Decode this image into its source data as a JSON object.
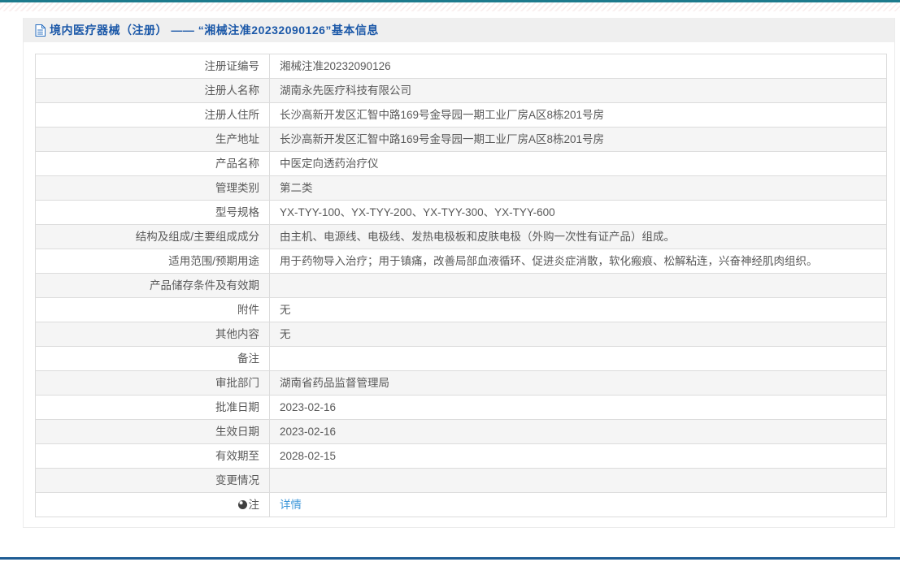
{
  "header": {
    "title": "境内医疗器械（注册） —— “湘械注准20232090126”基本信息"
  },
  "icons": {
    "document_icon": "document-outline-icon",
    "note_icon": "dark-circle-note-icon"
  },
  "colors": {
    "top_line_teal": "#1d7a8c",
    "bottom_line_blue": "#1e5c94",
    "title_blue": "#1b58a8",
    "link_blue": "#3e97d9",
    "header_bar_gray": "#efefef",
    "row_alt_gray": "#f5f5f5",
    "table_border": "#dcdcdc",
    "text_gray": "#595959"
  },
  "table": {
    "rows": [
      {
        "label": "注册证编号",
        "value": "湘械注准20232090126"
      },
      {
        "label": "注册人名称",
        "value": "湖南永先医疗科技有限公司"
      },
      {
        "label": "注册人住所",
        "value": "长沙高新开发区汇智中路169号金导园一期工业厂房A区8栋201号房"
      },
      {
        "label": "生产地址",
        "value": "长沙高新开发区汇智中路169号金导园一期工业厂房A区8栋201号房"
      },
      {
        "label": "产品名称",
        "value": "中医定向透药治疗仪"
      },
      {
        "label": "管理类别",
        "value": "第二类"
      },
      {
        "label": "型号规格",
        "value": "YX-TYY-100、YX-TYY-200、YX-TYY-300、YX-TYY-600"
      },
      {
        "label": "结构及组成/主要组成成分",
        "value": "由主机、电源线、电极线、发热电极板和皮肤电极（外购一次性有证产品）组成。"
      },
      {
        "label": "适用范围/预期用途",
        "value": "用于药物导入治疗；用于镇痛，改善局部血液循环、促进炎症消散，软化瘢痕、松解粘连，兴奋神经肌肉组织。"
      },
      {
        "label": "产品储存条件及有效期",
        "value": ""
      },
      {
        "label": "附件",
        "value": "无"
      },
      {
        "label": "其他内容",
        "value": "无"
      },
      {
        "label": "备注",
        "value": ""
      },
      {
        "label": "审批部门",
        "value": "湖南省药品监督管理局"
      },
      {
        "label": "批准日期",
        "value": "2023-02-16"
      },
      {
        "label": "生效日期",
        "value": "2023-02-16"
      },
      {
        "label": "有效期至",
        "value": "2028-02-15"
      },
      {
        "label": "变更情况",
        "value": ""
      },
      {
        "label": "注",
        "value": "详情",
        "link": true,
        "icon": "note-icon"
      }
    ]
  }
}
